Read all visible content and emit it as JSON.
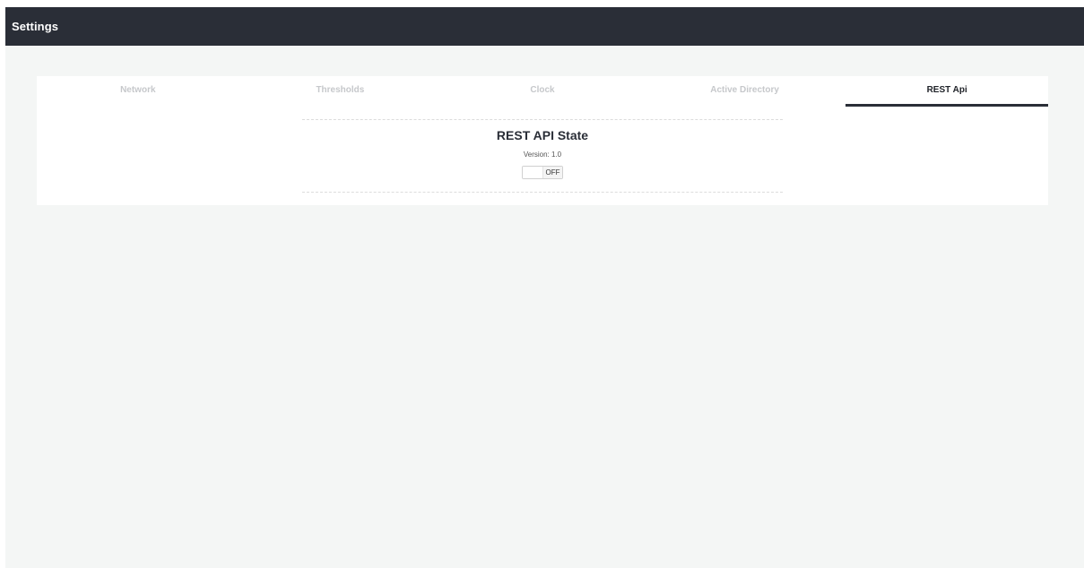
{
  "header": {
    "title": "Settings"
  },
  "tabs": [
    {
      "label": "Network",
      "active": false
    },
    {
      "label": "Thresholds",
      "active": false
    },
    {
      "label": "Clock",
      "active": false
    },
    {
      "label": "Active Directory",
      "active": false
    },
    {
      "label": "REST Api",
      "active": true
    }
  ],
  "rest_api": {
    "heading": "REST API State",
    "version": "Version: 1.0",
    "toggle_state": "OFF",
    "enabled": false
  },
  "colors": {
    "topbar": "#2a2e37",
    "background": "#f4f6f5",
    "inactive_tab_text": "#c6c8cb",
    "active_tab": "#2a2e37"
  }
}
